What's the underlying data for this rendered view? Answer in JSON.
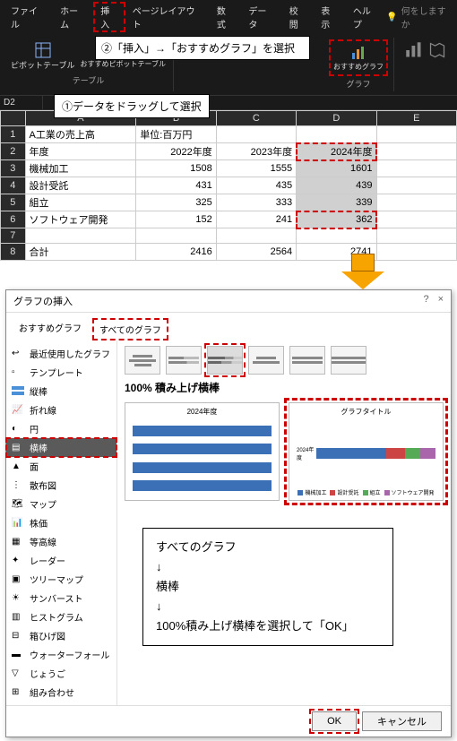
{
  "menu": {
    "items": [
      "ファイル",
      "ホーム",
      "挿入",
      "ページレイアウト",
      "数式",
      "データ",
      "校閲",
      "表示",
      "ヘルプ"
    ],
    "highlight_index": 2,
    "search_placeholder": "何をしますか"
  },
  "ribbon": {
    "pivot": "ピボットテーブル",
    "recommend_pivot": "おすすめピボットテーブル",
    "table_group": "テーブル",
    "recommend_chart": "おすすめグラフ",
    "chart_group": "グラフ"
  },
  "callouts": {
    "c2": "②「挿入」→「おすすめグラフ」を選択",
    "c1": "①データをドラッグして選択"
  },
  "ref": "D2",
  "sheet": {
    "cols": [
      "",
      "A",
      "B",
      "C",
      "D",
      "E"
    ],
    "rows": [
      {
        "n": "1",
        "cells": [
          "A工業の売上高",
          "単位:百万円",
          "",
          "",
          ""
        ]
      },
      {
        "n": "2",
        "cells": [
          "年度",
          "2022年度",
          "2023年度",
          "2024年度",
          ""
        ]
      },
      {
        "n": "3",
        "cells": [
          "機械加工",
          "1508",
          "1555",
          "1601",
          ""
        ]
      },
      {
        "n": "4",
        "cells": [
          "設計受託",
          "431",
          "435",
          "439",
          ""
        ]
      },
      {
        "n": "5",
        "cells": [
          "組立",
          "325",
          "333",
          "339",
          ""
        ]
      },
      {
        "n": "6",
        "cells": [
          "ソフトウェア開発",
          "152",
          "241",
          "362",
          ""
        ]
      },
      {
        "n": "7",
        "cells": [
          "",
          "",
          "",
          "",
          ""
        ]
      },
      {
        "n": "8",
        "cells": [
          "合計",
          "2416",
          "2564",
          "2741",
          ""
        ]
      }
    ]
  },
  "dialog": {
    "title": "グラフの挿入",
    "tabs": [
      "おすすめグラフ",
      "すべてのグラフ"
    ],
    "side": [
      "最近使用したグラフ",
      "テンプレート",
      "縦棒",
      "折れ線",
      "円",
      "横棒",
      "面",
      "散布図",
      "マップ",
      "株価",
      "等高線",
      "レーダー",
      "ツリーマップ",
      "サンバースト",
      "ヒストグラム",
      "箱ひげ図",
      "ウォーターフォール",
      "じょうご",
      "組み合わせ"
    ],
    "side_selected": 5,
    "subtype_title": "100% 積み上げ横棒",
    "preview1_title": "2024年度",
    "preview2_title": "グラフタイトル",
    "preview2_ylabel": "2024年度",
    "legend": [
      "機械加工",
      "設計受託",
      "組立",
      "ソフトウェア開発"
    ],
    "ok": "OK",
    "cancel": "キャンセル"
  },
  "instruction": {
    "l1": "すべてのグラフ",
    "l2": "↓",
    "l3": "横棒",
    "l4": "↓",
    "l5": "100%積み上げ横棒を選択して「OK」"
  },
  "colors": {
    "c1": "#3b6fb6",
    "c2": "#c44",
    "c3": "#5a5",
    "c4": "#a6a"
  },
  "chart_data": {
    "type": "bar",
    "orientation": "horizontal-stacked-100",
    "categories": [
      "2024年度"
    ],
    "series": [
      {
        "name": "機械加工",
        "values": [
          1601
        ]
      },
      {
        "name": "設計受託",
        "values": [
          439
        ]
      },
      {
        "name": "組立",
        "values": [
          339
        ]
      },
      {
        "name": "ソフトウェア開発",
        "values": [
          362
        ]
      }
    ],
    "title": "グラフタイトル",
    "xlabel": "",
    "ylabel": ""
  }
}
